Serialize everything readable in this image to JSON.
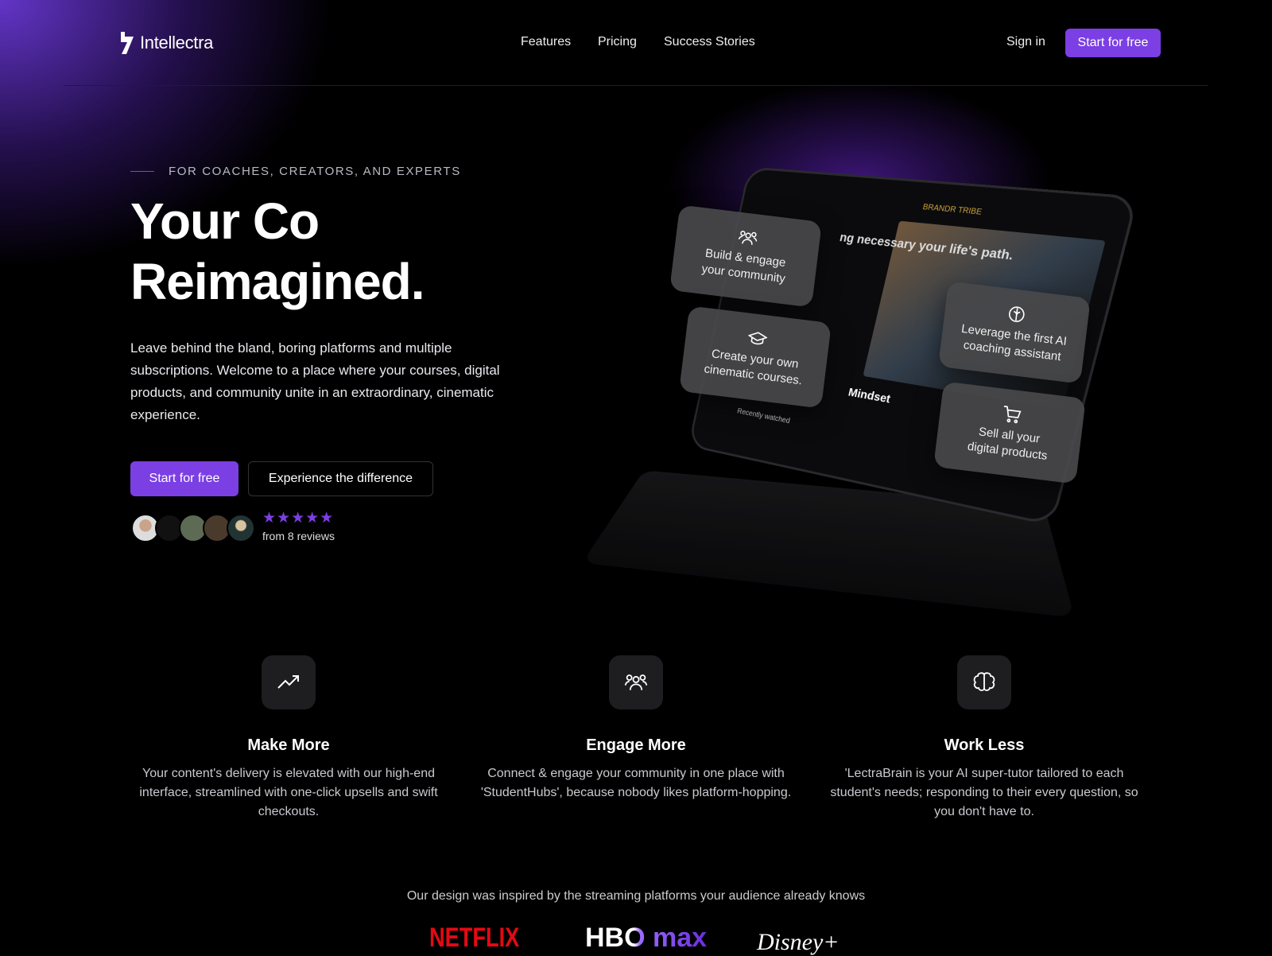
{
  "nav": {
    "brand": "Intellectra",
    "links": [
      "Features",
      "Pricing",
      "Success Stories"
    ],
    "sign_in": "Sign in",
    "cta": "Start for free"
  },
  "hero": {
    "eyebrow": "FOR COACHES, CREATORS, AND EXPERTS",
    "title_line1": "Your Co",
    "title_line2": "Reimagined.",
    "description": "Leave behind the bland, boring platforms and multiple subscriptions. Welcome to a place where your courses, digital products, and community unite in an extraordinary, cinematic experience.",
    "primary_cta": "Start for free",
    "secondary_cta": "Experience the difference",
    "rating": 5,
    "stars": "★★★★★",
    "reviews": "from 8 reviews"
  },
  "mockup": {
    "brand": "BRANDR TRIBE",
    "headline": "ng necessary your life's path.",
    "series": "Mindset",
    "recent": "Recently watched",
    "cards": [
      "Build & engage your community",
      "Create your own cinematic courses.",
      "Leverage the first AI coaching assistant",
      "Sell all your digital products"
    ]
  },
  "features": [
    {
      "icon": "trending-up-icon",
      "title": "Make More",
      "desc": "Your content's delivery is elevated with our high-end interface, streamlined with one-click upsells and swift checkouts."
    },
    {
      "icon": "users-icon",
      "title": "Engage More",
      "desc": "Connect & engage your community in one place with 'StudentHubs', because nobody likes platform-hopping."
    },
    {
      "icon": "brain-icon",
      "title": "Work Less",
      "desc": "'LectraBrain is your AI super-tutor tailored to each student's needs; responding to their every question, so you don't have to."
    }
  ],
  "inspired": {
    "text": "Our design was inspired by the streaming platforms your audience already knows",
    "logos": [
      "NETFLIX",
      "HBO max",
      "Disney+"
    ]
  },
  "colors": {
    "accent": "#7b3fe4",
    "netflix": "#e50914"
  }
}
